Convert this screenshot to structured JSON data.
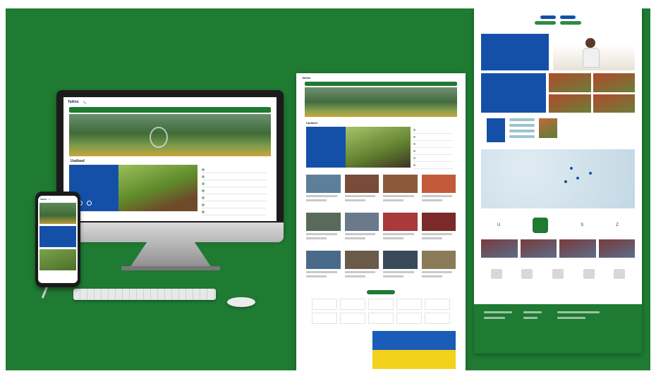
{
  "desktop": {
    "logo": "Tallinn",
    "nav_items": [
      "",
      "",
      "",
      "",
      "",
      ""
    ],
    "section_title": "Uudised"
  },
  "colors": {
    "background_green": "#1f7a32",
    "brand_blue": "#1550a8",
    "flag_yellow": "#f2d21b"
  },
  "icons": [
    "search-icon",
    "menu-icon",
    "play-icon"
  ]
}
